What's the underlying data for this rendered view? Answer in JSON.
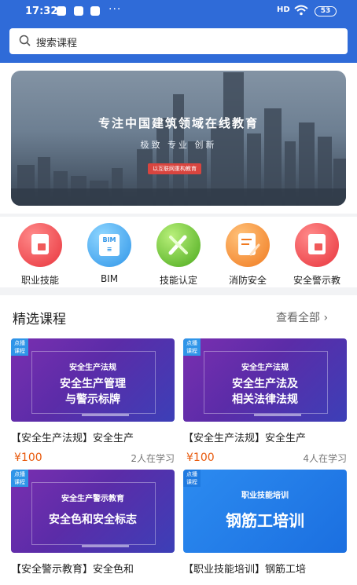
{
  "status_bar": {
    "time": "17:32",
    "dots": "···",
    "signal": "HD",
    "battery": "53"
  },
  "search": {
    "placeholder": "搜索课程"
  },
  "banner": {
    "title": "专注中国建筑领域在线教育",
    "subtitle": "极致 专业 创新",
    "tag": "以互联网重构教育"
  },
  "categories": [
    {
      "label": "职业技能",
      "icon": "document-icon",
      "color": "#e8343c"
    },
    {
      "label": "BIM",
      "icon": "bim-icon",
      "color": "#2f95e8"
    },
    {
      "label": "技能认定",
      "icon": "tools-icon",
      "color": "#4aa91c"
    },
    {
      "label": "消防安全",
      "icon": "edit-document-icon",
      "color": "#f07a20"
    },
    {
      "label": "安全警示教",
      "icon": "document-icon",
      "color": "#e8343c"
    }
  ],
  "section": {
    "title": "精选课程",
    "more": "查看全部"
  },
  "courses": [
    {
      "badge": "点播\n课程",
      "thumb_line1": "安全生产法规",
      "thumb_line2": "安全生产管理\n与警示标牌",
      "title": "【安全生产法规】安全生产",
      "price": "¥100",
      "learners": "2人在学习"
    },
    {
      "badge": "点播\n课程",
      "thumb_line1": "安全生产法规",
      "thumb_line2": "安全生产法及\n相关法律法规",
      "title": "【安全生产法规】安全生产",
      "price": "¥100",
      "learners": "4人在学习"
    },
    {
      "badge": "点播\n课程",
      "thumb_line1": "安全生产警示教育",
      "thumb_line2": "安全色和安全标志",
      "title": "【安全警示教育】安全色和"
    },
    {
      "badge": "点播\n课程",
      "thumb_line1": "职业技能培训",
      "thumb_line2": "钢筋工培训",
      "title": "【职业技能培训】钢筋工培"
    }
  ],
  "colors": {
    "header": "#2f6bd8",
    "price": "#e8590c"
  }
}
